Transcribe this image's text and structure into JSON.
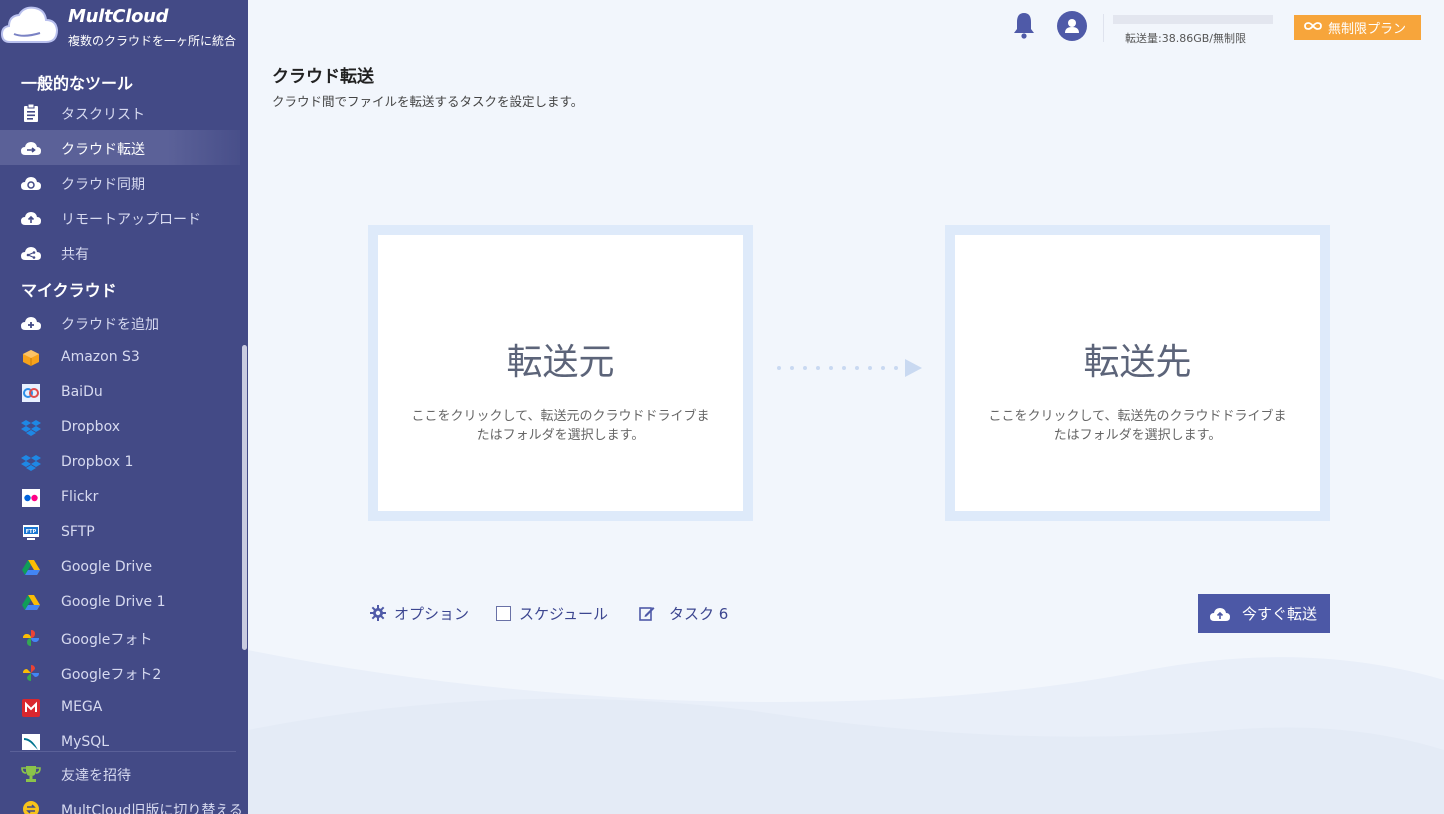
{
  "brand": {
    "title": "MultCloud",
    "subtitle": "複数のクラウドを一ヶ所に統合"
  },
  "sidebar": {
    "tools_heading": "一般的なツール",
    "tools": [
      {
        "label": "タスクリスト",
        "icon": "clipboard-icon"
      },
      {
        "label": "クラウド転送",
        "icon": "cloud-transfer-icon",
        "active": true
      },
      {
        "label": "クラウド同期",
        "icon": "cloud-sync-icon"
      },
      {
        "label": "リモートアップロード",
        "icon": "cloud-upload-icon"
      },
      {
        "label": "共有",
        "icon": "cloud-share-icon"
      }
    ],
    "clouds_heading": "マイクラウド",
    "clouds": [
      {
        "label": "クラウドを追加",
        "icon": "cloud-add-icon"
      },
      {
        "label": "Amazon S3",
        "icon": "amazon-s3-icon"
      },
      {
        "label": "BaiDu",
        "icon": "baidu-icon"
      },
      {
        "label": "Dropbox",
        "icon": "dropbox-icon"
      },
      {
        "label": "Dropbox 1",
        "icon": "dropbox-icon"
      },
      {
        "label": "Flickr",
        "icon": "flickr-icon"
      },
      {
        "label": "SFTP",
        "icon": "sftp-icon"
      },
      {
        "label": "Google Drive",
        "icon": "google-drive-icon"
      },
      {
        "label": "Google Drive 1",
        "icon": "google-drive-icon"
      },
      {
        "label": "Googleフォト",
        "icon": "google-photos-icon"
      },
      {
        "label": "Googleフォト2",
        "icon": "google-photos-icon"
      },
      {
        "label": "MEGA",
        "icon": "mega-icon"
      },
      {
        "label": "MySQL",
        "icon": "mysql-icon"
      }
    ],
    "footer": [
      {
        "label": "友達を招待",
        "icon": "trophy-icon"
      },
      {
        "label": "MultCloud旧版に切り替える",
        "icon": "switch-icon"
      }
    ]
  },
  "header": {
    "quota_text": "転送量:38.86GB/無制限",
    "plan_label": "無制限プラン"
  },
  "page": {
    "title": "クラウド転送",
    "description": "クラウド間でファイルを転送するタスクを設定します。"
  },
  "source": {
    "title": "転送元",
    "description": "ここをクリックして、転送元のクラウドドライブまたはフォルダを選択します。"
  },
  "destination": {
    "title": "転送先",
    "description": "ここをクリックして、転送先のクラウドドライブまたはフォルダを選択します。"
  },
  "controls": {
    "options_label": "オプション",
    "schedule_label": "スケジュール",
    "task_label": "タスク 6",
    "transfer_button": "今すぐ転送"
  },
  "colors": {
    "sidebar": "#434a86",
    "accent": "#4c58a6",
    "plan": "#f7a53b"
  }
}
